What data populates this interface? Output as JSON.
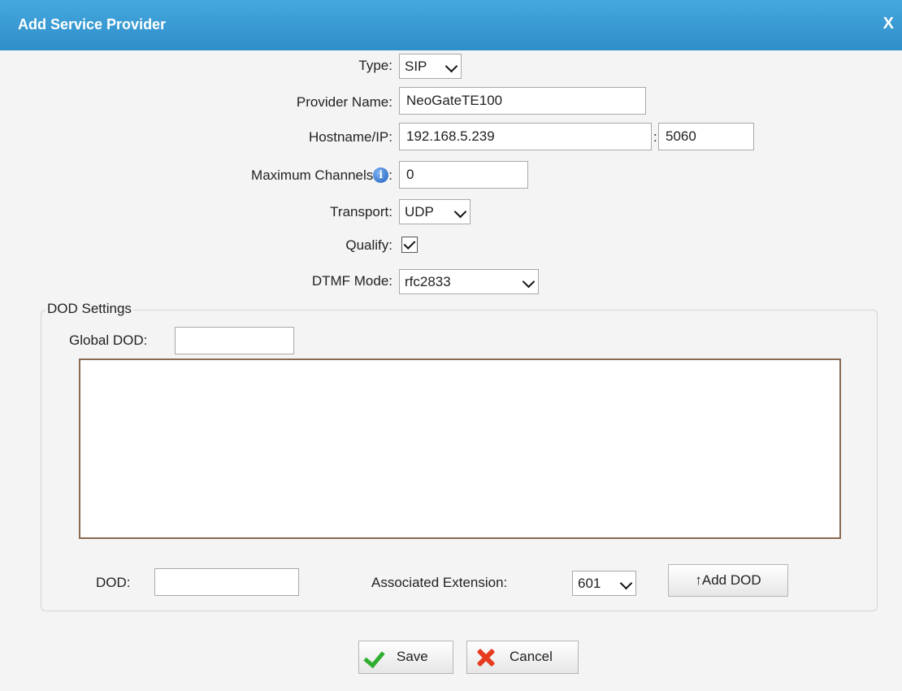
{
  "dialog": {
    "title": "Add Service Provider",
    "close_label": "X"
  },
  "form": {
    "type": {
      "label": "Type:",
      "value": "SIP"
    },
    "provider_name": {
      "label": "Provider Name:",
      "value": "NeoGateTE100"
    },
    "hostname": {
      "label": "Hostname/IP:",
      "value": "192.168.5.239",
      "port_separator": ":",
      "port": "5060"
    },
    "max_channels": {
      "label": "Maximum Channels",
      "label_suffix": ":",
      "value": "0",
      "info_icon": "info-icon"
    },
    "transport": {
      "label": "Transport:",
      "value": "UDP"
    },
    "qualify": {
      "label": "Qualify:",
      "checked": true
    },
    "dtmf_mode": {
      "label": "DTMF Mode:",
      "value": "rfc2833"
    }
  },
  "dod_settings": {
    "legend": "DOD Settings",
    "global_dod": {
      "label": "Global DOD:",
      "value": ""
    },
    "dod": {
      "label": "DOD:",
      "value": ""
    },
    "associated_extension": {
      "label": "Associated Extension:",
      "value": "601"
    },
    "add_dod_label": "↑Add DOD"
  },
  "actions": {
    "save_label": "Save",
    "cancel_label": "Cancel"
  },
  "colors": {
    "titlebar": "#3a9ad5",
    "save_icon": "#2fae2f",
    "cancel_icon": "#e63b1f"
  }
}
